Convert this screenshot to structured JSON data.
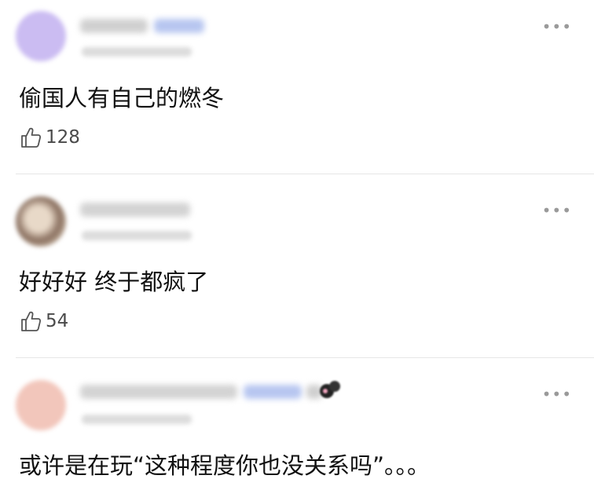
{
  "comments": [
    {
      "text": "偷国人有自己的燃冬",
      "likes": "128",
      "more": "•••",
      "avatar_color": "#cbbcf2"
    },
    {
      "text": "好好好 终于都疯了",
      "likes": "54",
      "more": "•••",
      "avatar_color": "#c9b7a3"
    },
    {
      "text": "或许是在玩“这种程度你也没关系吗”。。。",
      "more": "•••",
      "avatar_color": "#f2c6bb"
    }
  ],
  "colors": {
    "divider": "#e6e6e6",
    "badge": "#b7c6f0",
    "meta": "#dcdcdc",
    "icon": "#555555"
  },
  "icons": {
    "like": "thumbs-up-icon",
    "more": "more-dots-icon"
  }
}
